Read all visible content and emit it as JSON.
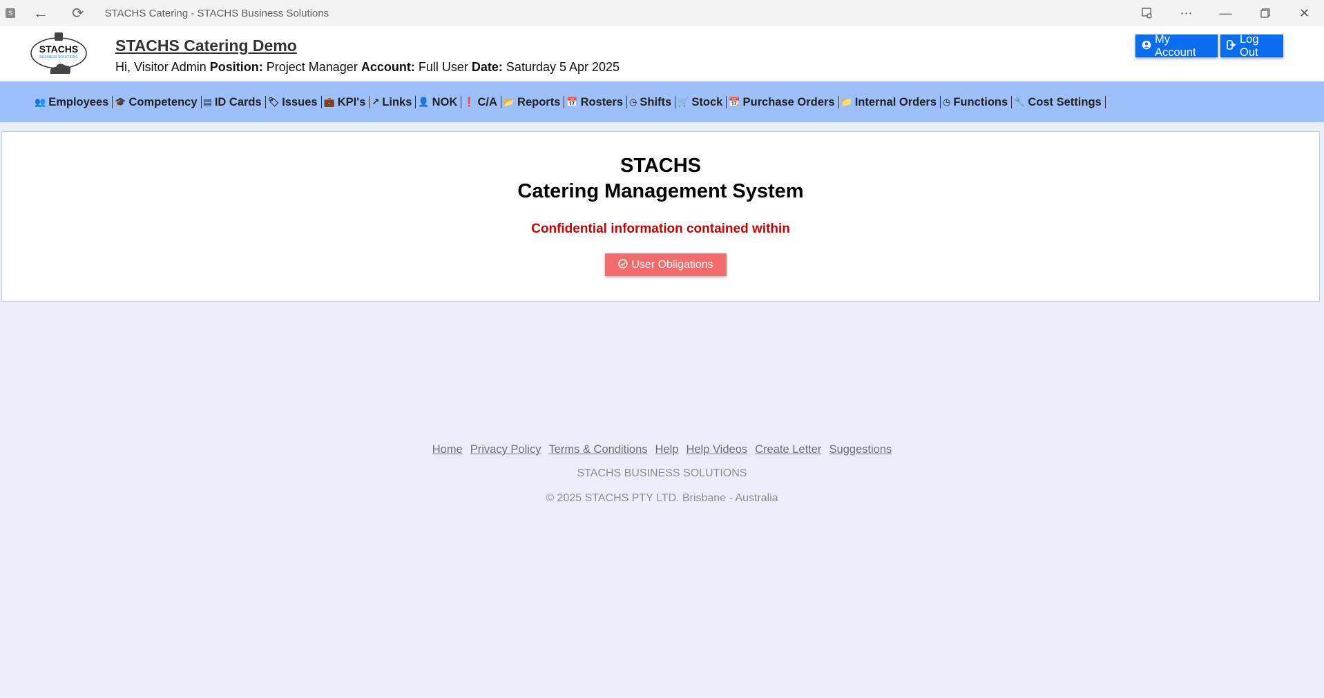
{
  "window": {
    "title": "STACHS Catering - STACHS Business Solutions",
    "app_icon_letter": "S"
  },
  "header": {
    "logo_text": "STACHS",
    "logo_subtext": "BUSINESS SOLUTIONS",
    "site_title": "STACHS Catering Demo",
    "greeting": "Hi, Visitor Admin",
    "position_label": "Position:",
    "position_value": "Project Manager",
    "account_label": "Account:",
    "account_value": "Full User",
    "date_label": "Date:",
    "date_value": "Saturday 5 Apr 2025",
    "my_account_label": "My Account",
    "logout_label": "Log Out"
  },
  "nav": {
    "items": [
      {
        "label": "Employees",
        "icon": "users-icon",
        "glyph": "👥"
      },
      {
        "label": "Competency",
        "icon": "graduation-cap-icon",
        "glyph": "🎓"
      },
      {
        "label": "ID Cards",
        "icon": "id-card-icon",
        "glyph": "▤"
      },
      {
        "label": "Issues",
        "icon": "tags-icon",
        "glyph": "🏷"
      },
      {
        "label": "KPI's",
        "icon": "briefcase-icon",
        "glyph": "💼"
      },
      {
        "label": "Links",
        "icon": "external-link-icon",
        "glyph": "↗"
      },
      {
        "label": "NOK",
        "icon": "user-icon",
        "glyph": "👤"
      },
      {
        "label": "C/A",
        "icon": "exclamation-circle-icon",
        "glyph": "❗"
      },
      {
        "label": "Reports",
        "icon": "folder-open-icon",
        "glyph": "📂"
      },
      {
        "label": "Rosters",
        "icon": "calendar-icon",
        "glyph": "📅"
      },
      {
        "label": "Shifts",
        "icon": "clock-icon",
        "glyph": "◷"
      },
      {
        "label": "Stock",
        "icon": "shopping-cart-icon",
        "glyph": "🛒"
      },
      {
        "label": "Purchase Orders",
        "icon": "calendar-plus-icon",
        "glyph": "📆"
      },
      {
        "label": "Internal Orders",
        "icon": "folder-icon",
        "glyph": "📁"
      },
      {
        "label": "Functions",
        "icon": "clock-icon",
        "glyph": "◷"
      },
      {
        "label": "Cost Settings",
        "icon": "wrench-icon",
        "glyph": "🔧"
      }
    ]
  },
  "main": {
    "title_line1": "STACHS",
    "title_line2": "Catering Management System",
    "subtitle": "Confidential information contained within",
    "obligations_button": "User Obligations"
  },
  "footer": {
    "links": [
      "Home",
      "Privacy Policy",
      "Terms & Conditions",
      "Help",
      "Help Videos",
      "Create Letter",
      "Suggestions"
    ],
    "company": "STACHS BUSINESS SOLUTIONS",
    "copyright": "© 2025 STACHS PTY LTD. Brisbane - Australia"
  },
  "colors": {
    "nav_bg": "#9dc0fb",
    "page_bg": "#e9eef8",
    "primary_button": "#0a6df0",
    "danger_button": "#f36b6b",
    "confidential_text": "#cc0000"
  }
}
